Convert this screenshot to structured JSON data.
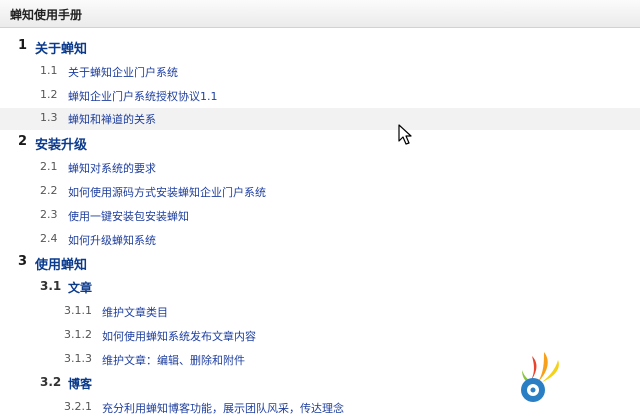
{
  "window": {
    "title": "蝉知使用手册"
  },
  "toc": [
    {
      "level": 1,
      "num": "1",
      "text": "关于蝉知"
    },
    {
      "level": 2,
      "num": "1.1",
      "text": "关于蝉知企业门户系统"
    },
    {
      "level": 2,
      "num": "1.2",
      "text": "蝉知企业门户系统授权协议1.1"
    },
    {
      "level": 2,
      "num": "1.3",
      "text": "蝉知和禅道的关系",
      "highlighted": true
    },
    {
      "level": 1,
      "num": "2",
      "text": "安装升级"
    },
    {
      "level": 2,
      "num": "2.1",
      "text": "蝉知对系统的要求"
    },
    {
      "level": 2,
      "num": "2.2",
      "text": "如何使用源码方式安装蝉知企业门户系统"
    },
    {
      "level": 2,
      "num": "2.3",
      "text": "使用一键安装包安装蝉知"
    },
    {
      "level": 2,
      "num": "2.4",
      "text": "如何升级蝉知系统"
    },
    {
      "level": 1,
      "num": "3",
      "text": "使用蝉知"
    },
    {
      "level": "2b",
      "num": "3.1",
      "text": "文章"
    },
    {
      "level": 3,
      "num": "3.1.1",
      "text": "维护文章类目"
    },
    {
      "level": 3,
      "num": "3.1.2",
      "text": "如何使用蝉知系统发布文章内容"
    },
    {
      "level": 3,
      "num": "3.1.3",
      "text": "维护文章：编辑、删除和附件"
    },
    {
      "level": "2b",
      "num": "3.2",
      "text": "博客"
    },
    {
      "level": 3,
      "num": "3.2.1",
      "text": "充分利用蝉知博客功能，展示团队风采，传达理念"
    }
  ],
  "icons": {
    "cursor": "mouse-pointer-icon",
    "logo": "app-logo-icon"
  }
}
